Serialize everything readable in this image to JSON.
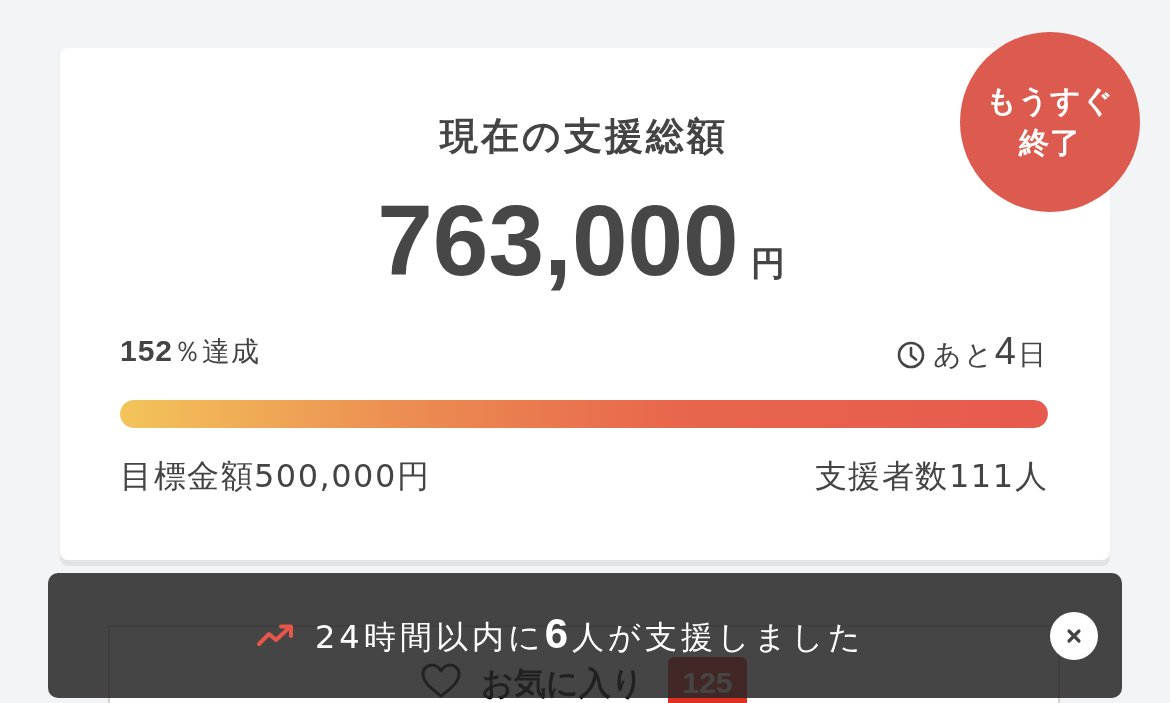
{
  "summary": {
    "title": "現在の支援総額",
    "amount": "763,000",
    "unit": "円",
    "badge": "もうすぐ終了",
    "achievement": "**152**％達成",
    "remaining": "あと**4**日",
    "progress": {
      "level": 1
    },
    "goal": "目標金額500,000円",
    "backers": "支援者数111人"
  },
  "favorite": {
    "label": "お気に入り",
    "count": "125"
  },
  "toast": {
    "message": "24時間以内に**6**人が支援しました"
  }
}
